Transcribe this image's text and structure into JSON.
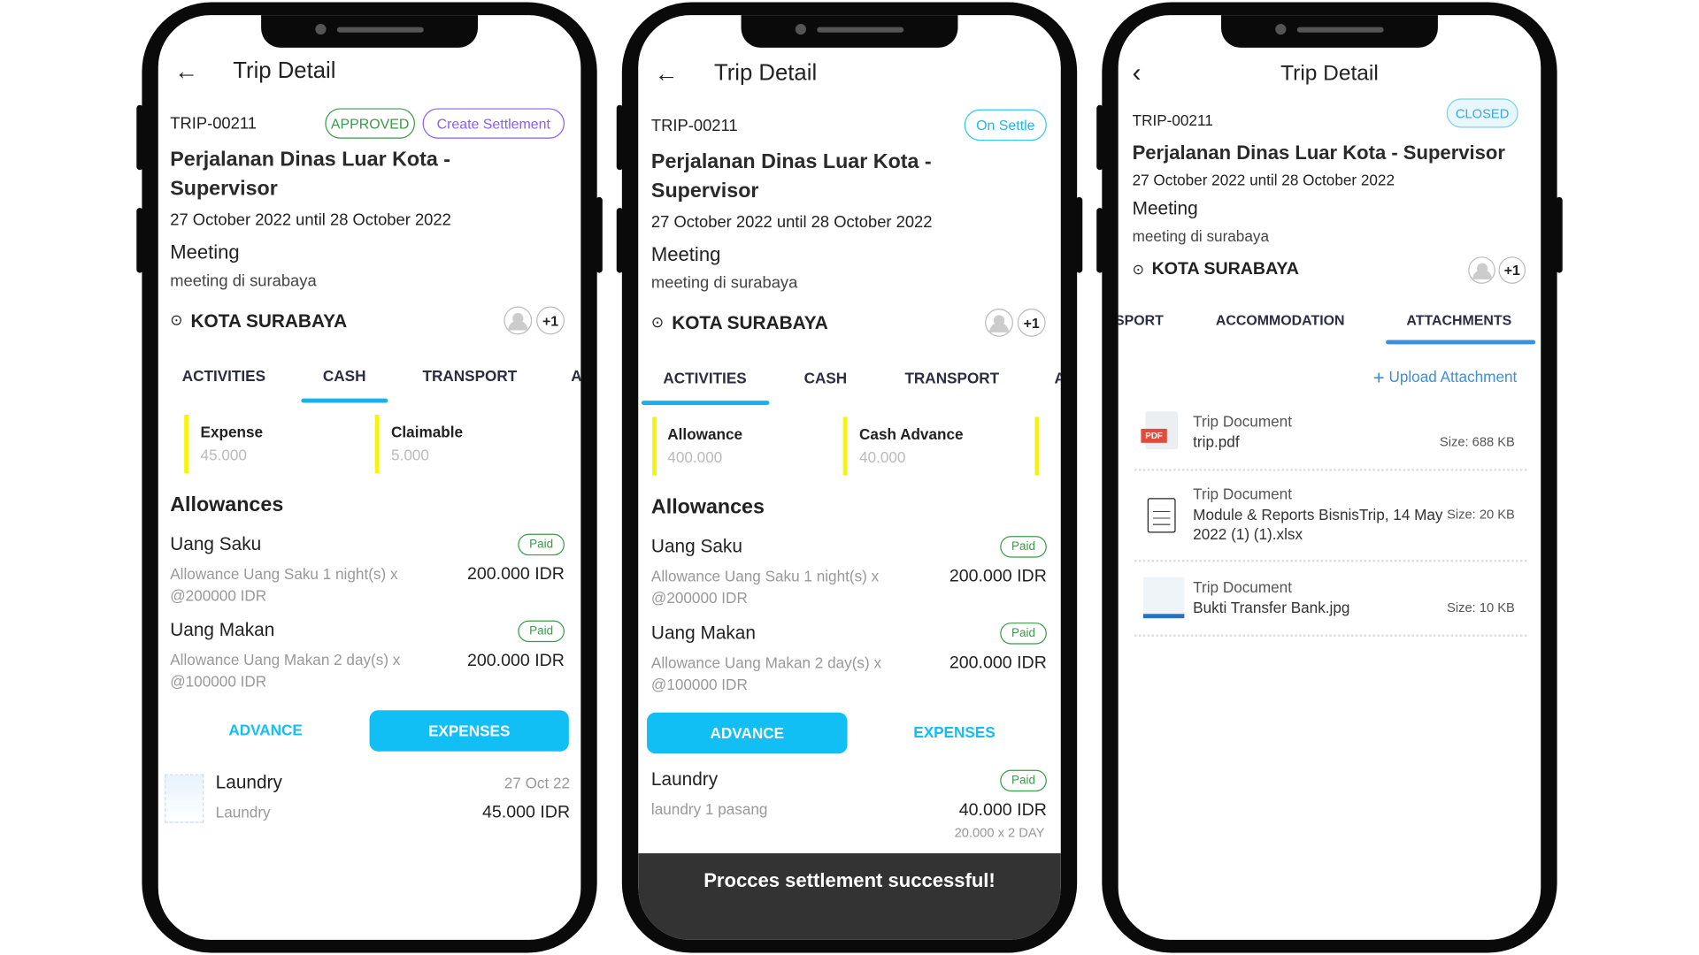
{
  "colors": {
    "accent": "#12bff5",
    "approved": "#3a9a48",
    "settlement": "#8b5cf6",
    "closed": "#3b8fe0",
    "paid": "#3a9a48",
    "card_bar": "#f5f50a",
    "toast_bg": "#333333"
  },
  "phones": [
    {
      "header": {
        "back_icon": "arrow-left-icon",
        "title": "Trip Detail"
      },
      "trip_id": "TRIP-00211",
      "status": "APPROVED",
      "action": "Create Settlement",
      "trip_title": [
        "Perjalanan Dinas Luar Kota -",
        "Supervisor"
      ],
      "dates": "27 October 2022 until 28 October 2022",
      "purpose": "Meeting",
      "description": "meeting di surabaya",
      "location": "KOTA SURABAYA",
      "participants_extra": "+1",
      "tabs": [
        "ACTIVITIES",
        "CASH",
        "TRANSPORT",
        "A"
      ],
      "active_tab": "CASH",
      "cards": [
        {
          "label": "Expense",
          "value": "45.000"
        },
        {
          "label": "Claimable",
          "value": "5.000"
        }
      ],
      "allowances_title": "Allowances",
      "allowances": [
        {
          "name": "Uang Saku",
          "status": "Paid",
          "desc": [
            "Allowance Uang Saku 1 night(s) x",
            "@200000 IDR"
          ],
          "amount": "200.000 IDR"
        },
        {
          "name": "Uang Makan",
          "status": "Paid",
          "desc": [
            "Allowance Uang Makan 2 day(s) x",
            "@100000 IDR"
          ],
          "amount": "200.000 IDR"
        }
      ],
      "segment": {
        "advance": "ADVANCE",
        "expenses": "EXPENSES",
        "active": "EXPENSES"
      },
      "expense": {
        "name": "Laundry",
        "date": "27 Oct 22",
        "desc": "Laundry",
        "amount": "45.000 IDR"
      }
    },
    {
      "header": {
        "back_icon": "arrow-left-icon",
        "title": "Trip Detail"
      },
      "trip_id": "TRIP-00211",
      "status": "On Settle",
      "trip_title": [
        "Perjalanan Dinas Luar Kota -",
        "Supervisor"
      ],
      "dates": "27 October 2022 until 28 October 2022",
      "purpose": "Meeting",
      "description": "meeting di surabaya",
      "location": "KOTA SURABAYA",
      "participants_extra": "+1",
      "tabs": [
        "ACTIVITIES",
        "CASH",
        "TRANSPORT",
        "A"
      ],
      "active_tab": "ACTIVITIES",
      "cards": [
        {
          "label": "Allowance",
          "value": "400.000"
        },
        {
          "label": "Cash Advance",
          "value": "40.000"
        }
      ],
      "allowances_title": "Allowances",
      "allowances": [
        {
          "name": "Uang Saku",
          "status": "Paid",
          "desc": [
            "Allowance Uang Saku 1 night(s) x",
            "@200000 IDR"
          ],
          "amount": "200.000 IDR"
        },
        {
          "name": "Uang Makan",
          "status": "Paid",
          "desc": [
            "Allowance Uang Makan 2 day(s) x",
            "@100000 IDR"
          ],
          "amount": "200.000 IDR"
        }
      ],
      "segment": {
        "advance": "ADVANCE",
        "expenses": "EXPENSES",
        "active": "ADVANCE"
      },
      "advance_item": {
        "name": "Laundry",
        "status": "Paid",
        "desc": "laundry 1 pasang",
        "amount": "40.000 IDR",
        "calc": "20.000 x 2 DAY"
      },
      "toast": "Procces settlement successful!"
    },
    {
      "header": {
        "back_icon": "chevron-left-icon",
        "title": "Trip Detail"
      },
      "trip_id": "TRIP-00211",
      "status": "CLOSED",
      "trip_title": "Perjalanan Dinas Luar Kota - Supervisor",
      "dates": "27 October 2022 until 28 October 2022",
      "purpose": "Meeting",
      "description": "meeting di surabaya",
      "location": "KOTA SURABAYA",
      "participants_extra": "+1",
      "tabs": [
        "SPORT",
        "ACCOMMODATION",
        "ATTACHMENTS"
      ],
      "active_tab": "ATTACHMENTS",
      "upload_label": "Upload Attachment",
      "attachments": [
        {
          "type": "Trip Document",
          "name": "trip.pdf",
          "size": "Size: 688 KB",
          "icon": "pdf-file-icon",
          "badge": "PDF"
        },
        {
          "type": "Trip Document",
          "name": [
            "Module & Reports BisnisTrip, 14 May",
            "2022 (1) (1).xlsx"
          ],
          "size": "Size: 20 KB",
          "icon": "document-icon"
        },
        {
          "type": "Trip Document",
          "name": "Bukti Transfer Bank.jpg",
          "size": "Size: 10 KB",
          "icon": "image-thumbnail-icon"
        }
      ]
    }
  ]
}
